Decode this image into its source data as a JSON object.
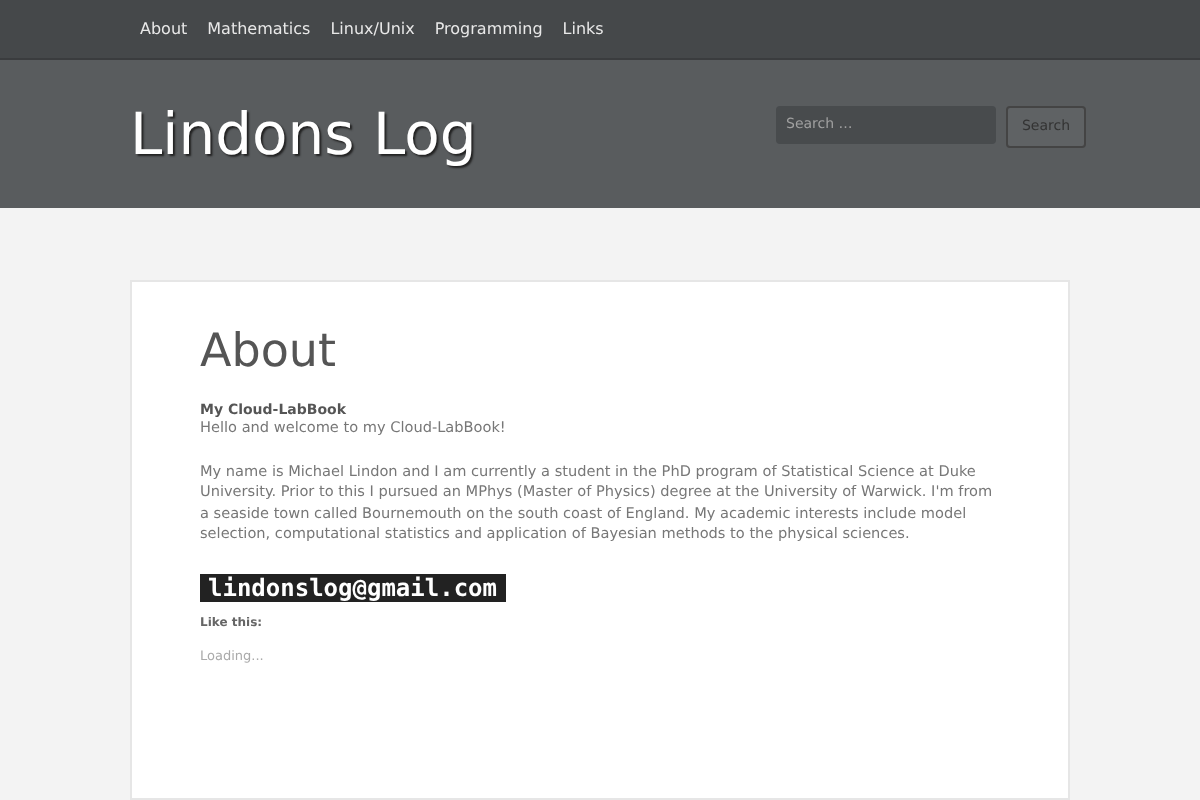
{
  "nav": {
    "items": [
      {
        "label": "About"
      },
      {
        "label": "Mathematics"
      },
      {
        "label": "Linux/Unix"
      },
      {
        "label": "Programming"
      },
      {
        "label": "Links"
      }
    ]
  },
  "header": {
    "site_title": "Lindons Log",
    "search": {
      "placeholder": "Search …",
      "button": "Search"
    }
  },
  "page": {
    "title": "About",
    "subtitle": "My Cloud-LabBook",
    "greeting": "Hello and welcome to my Cloud-LabBook!",
    "paragraph": "My name is Michael Lindon and I am currently a student in the PhD program of Statistical Science at Duke University. Prior to this I pursued an MPhys (Master of Physics) degree at the University of Warwick. I'm from a seaside town called Bournemouth on the south coast of England. My academic interests include model selection, computational statistics and application of Bayesian methods to the physical sciences.",
    "email": "lindonslog@gmail.com",
    "like_heading": "Like this:",
    "loading": "Loading..."
  }
}
